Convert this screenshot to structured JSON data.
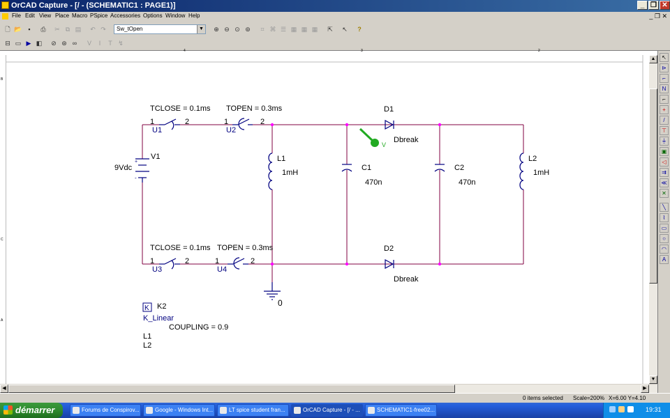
{
  "window": {
    "title": "OrCAD Capture - [/ - (SCHEMATIC1 : PAGE1)]",
    "buttons": [
      "_",
      "❐",
      "✕"
    ]
  },
  "menubar": {
    "items": [
      "File",
      "Edit",
      "View",
      "Place",
      "Macro",
      "PSpice",
      "Accessories",
      "Options",
      "Window",
      "Help"
    ],
    "mdi_controls": "_ ❐ ✕"
  },
  "toolbar": {
    "profile_value": "Sw_tOpen"
  },
  "ruler": {
    "top_marks": [
      "4",
      "3",
      "2"
    ],
    "left_marks": [
      "B",
      "C",
      "A"
    ]
  },
  "schematic": {
    "switches": [
      {
        "ref": "U1",
        "param": "TCLOSE = 0.1ms",
        "pin1": "1",
        "pin2": "2"
      },
      {
        "ref": "U2",
        "param": "TOPEN = 0.3ms",
        "pin1": "1",
        "pin2": "2"
      },
      {
        "ref": "U3",
        "param": "TCLOSE = 0.1ms",
        "pin1": "1",
        "pin2": "2"
      },
      {
        "ref": "U4",
        "param": "TOPEN = 0.3ms",
        "pin1": "1",
        "pin2": "2"
      }
    ],
    "source": {
      "ref": "V1",
      "value": "9Vdc",
      "plus": "+",
      "minus": "-"
    },
    "inductors": [
      {
        "ref": "L1",
        "value": "1mH"
      },
      {
        "ref": "L2",
        "value": "1mH"
      }
    ],
    "capacitors": [
      {
        "ref": "C1",
        "value": "470n"
      },
      {
        "ref": "C2",
        "value": "470n"
      }
    ],
    "diodes": [
      {
        "ref": "D1",
        "model": "Dbreak"
      },
      {
        "ref": "D2",
        "model": "Dbreak"
      }
    ],
    "probe_label": "V",
    "ground_label": "0",
    "coupling": {
      "ref": "K2",
      "box_letter": "K",
      "type": "K_Linear",
      "param": "COUPLING = 0.9",
      "inductor1": "L1",
      "inductor2": "L2"
    }
  },
  "statusbar": {
    "selection": "0 items selected",
    "scale": "Scale=200%",
    "coords": "X=6.00  Y=4.10"
  },
  "taskbar": {
    "start_label": "démarrer",
    "tasks": [
      "Forums de Conspirov...",
      "Google - Windows Int...",
      "LT spice student fran...",
      "OrCAD Capture - [/ - ...",
      "SCHEMATIC1-free02..."
    ],
    "lang": "FR",
    "clock": "19:31"
  },
  "colors": {
    "wire": "#800040",
    "node": "#ff00ff",
    "component": "#000080",
    "probe": "#22aa22",
    "titlebar": "#0a246a"
  }
}
